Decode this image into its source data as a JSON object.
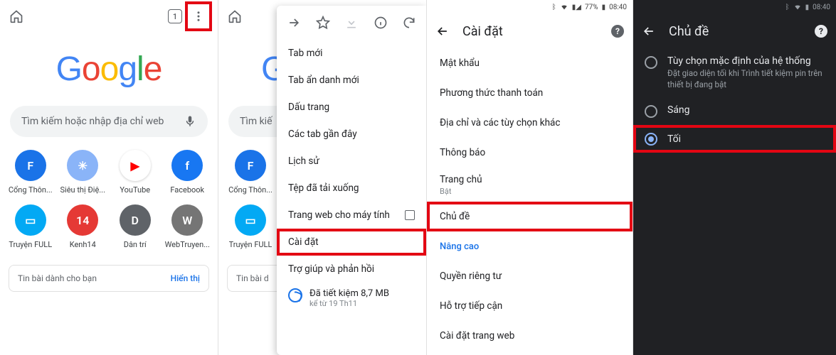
{
  "screen1": {
    "tab_count": "1",
    "search_placeholder": "Tìm kiếm hoặc nhập địa chỉ web",
    "tiles": [
      {
        "label": "Cổng Thôn...",
        "bg": "#1a73e8",
        "txt": "F"
      },
      {
        "label": "Siêu thị Điệ...",
        "bg": "#8ab4f8",
        "txt": "✳"
      },
      {
        "label": "YouTube",
        "bg": "#ffffff",
        "txt": "▶"
      },
      {
        "label": "Facebook",
        "bg": "#1877f2",
        "txt": "f"
      },
      {
        "label": "Truyện FULL",
        "bg": "#03a9f4",
        "txt": "▭"
      },
      {
        "label": "Kenh14",
        "bg": "#e53935",
        "txt": "14"
      },
      {
        "label": "Dân trí",
        "bg": "#5f6368",
        "txt": "D"
      },
      {
        "label": "WebTruyen...",
        "bg": "#757575",
        "txt": "W"
      }
    ],
    "feed_text": "Tin bài dành cho bạn",
    "feed_action": "Hiển thị"
  },
  "screen2": {
    "menu": {
      "new_tab": "Tab mới",
      "incognito": "Tab ẩn danh mới",
      "bookmarks": "Dấu trang",
      "recent_tabs": "Các tab gần đây",
      "history": "Lịch sử",
      "downloads": "Tệp đã tải xuống",
      "desktop_site": "Trang web cho máy tính",
      "settings": "Cài đặt",
      "help": "Trợ giúp và phản hồi",
      "data_saved_title": "Đã tiết kiệm 8,7 MB",
      "data_saved_sub": "kể từ 19 Th11"
    }
  },
  "screen3": {
    "status_battery": "77%",
    "status_time": "08:40",
    "title": "Cài đặt",
    "items": {
      "passwords": "Mật khẩu",
      "payments": "Phương thức thanh toán",
      "addresses": "Địa chỉ và các tùy chọn khác",
      "notifications": "Thông báo",
      "homepage": "Trang chủ",
      "homepage_sub": "Bật",
      "theme": "Chủ đề",
      "advanced": "Nâng cao",
      "privacy": "Quyền riêng tư",
      "accessibility": "Hỗ trợ tiếp cận",
      "site_settings": "Cài đặt trang web"
    }
  },
  "screen4": {
    "status_time": "08:40",
    "title": "Chủ đề",
    "opt_default_title": "Tùy chọn mặc định của hệ thống",
    "opt_default_desc": "Đặt giao diện tối khi Trình tiết kiệm pin trên thiết bị đang bật",
    "opt_light": "Sáng",
    "opt_dark": "Tối"
  }
}
